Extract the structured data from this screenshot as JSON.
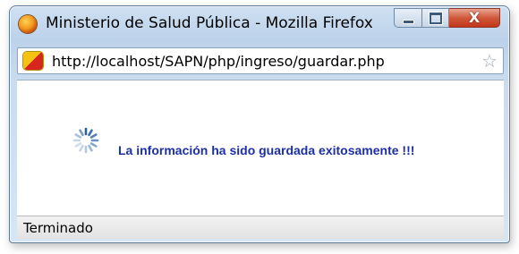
{
  "window": {
    "title": "Ministerio de Salud Pública - Mozilla Firefox",
    "icon": "firefox-icon",
    "controls": {
      "minimize": "minimize-icon",
      "maximize": "maximize-icon",
      "close_label": "X"
    }
  },
  "urlbar": {
    "site_icon": "site-favicon-icon",
    "url": "http://localhost/SAPN/php/ingreso/guardar.php",
    "bookmark_icon": "star-icon"
  },
  "content": {
    "spinner_icon": "loading-spinner-icon",
    "message": "La información ha sido guardada exitosamente !!!",
    "message_color": "#1c2fa6"
  },
  "status": {
    "text": "Terminado"
  }
}
